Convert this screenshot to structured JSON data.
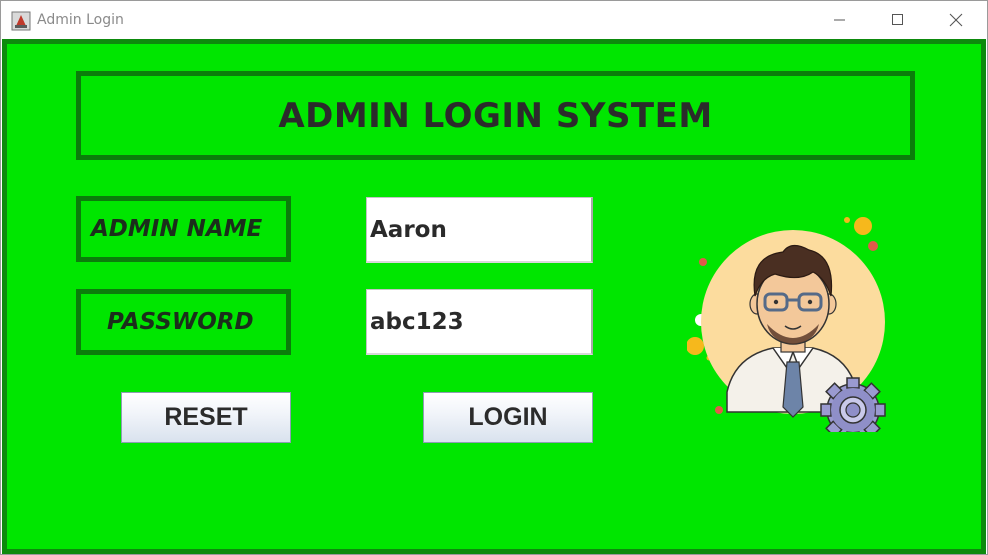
{
  "window": {
    "title": "Admin Login",
    "icons": {
      "app": "java-cup-icon",
      "minimize": "minimize-icon",
      "maximize": "maximize-icon",
      "close": "close-icon"
    }
  },
  "form": {
    "heading": "ADMIN LOGIN SYSTEM",
    "name_label": "ADMIN NAME",
    "name_value": "Aaron",
    "password_label": "PASSWORD",
    "password_value": "abc123",
    "reset_label": "RESET",
    "login_label": "LOGIN"
  },
  "illustration": {
    "icon": "admin-avatar-with-gear-icon"
  },
  "colors": {
    "background": "#00e600",
    "border": "#0b7d0b",
    "text": "#2b2b2b"
  }
}
